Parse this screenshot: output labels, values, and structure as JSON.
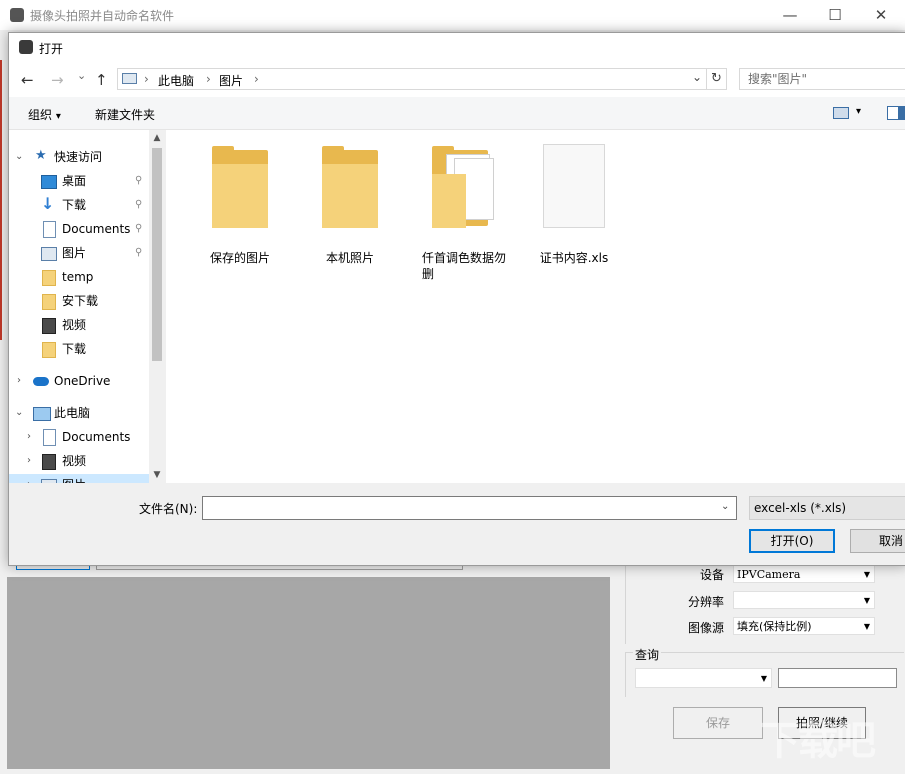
{
  "background_app": {
    "title": "摄像头拍照并自动命名软件",
    "minimize": "—",
    "maximize": "☐",
    "close": "✕",
    "device_label": "设备",
    "device_value": "IPVCamera",
    "resolution_label": "分辨率",
    "resolution_value": "",
    "source_label": "图像源",
    "source_value": "填充(保持比例)",
    "query_label": "查询",
    "save_label": "保存",
    "capture_label": "拍照/继续",
    "watermark": "下载吧"
  },
  "dialog": {
    "title": "打开",
    "nav": {
      "back_icon": "←",
      "forward_icon": "→",
      "recent_icon": "⌄",
      "up_icon": "↑",
      "breadcrumb": [
        "此电脑",
        "图片"
      ],
      "separator": "›",
      "dropdown_icon": "⌄",
      "refresh_icon": "↻",
      "search_placeholder": "搜索\"图片\""
    },
    "toolbar": {
      "organize": "组织",
      "organize_arrow": "▾",
      "new_folder": "新建文件夹",
      "view_arrow": "▾"
    },
    "tree": [
      {
        "label": "快速访问",
        "icon": "star-icon",
        "expand": "⌄",
        "pinned": false
      },
      {
        "label": "桌面",
        "icon": "desktop-icon",
        "expand": "",
        "pinned": true
      },
      {
        "label": "下载",
        "icon": "download-arrow-icon",
        "expand": "",
        "pinned": true
      },
      {
        "label": "Documents",
        "icon": "document-icon",
        "expand": "",
        "pinned": true
      },
      {
        "label": "图片",
        "icon": "pictures-icon",
        "expand": "",
        "pinned": true
      },
      {
        "label": "temp",
        "icon": "folder-icon",
        "expand": "",
        "pinned": false
      },
      {
        "label": "安下载",
        "icon": "folder-icon",
        "expand": "",
        "pinned": false
      },
      {
        "label": "视频",
        "icon": "video-icon",
        "expand": "",
        "pinned": false
      },
      {
        "label": "下载",
        "icon": "folder-icon",
        "expand": "",
        "pinned": false
      },
      {
        "label": "OneDrive",
        "icon": "cloud-icon",
        "expand": "›",
        "pinned": false
      },
      {
        "label": "此电脑",
        "icon": "computer-icon",
        "expand": "⌄",
        "pinned": false
      },
      {
        "label": "Documents",
        "icon": "document-icon",
        "expand": "›",
        "pinned": false
      },
      {
        "label": "视频",
        "icon": "video-icon",
        "expand": "›",
        "pinned": false
      },
      {
        "label": "图片",
        "icon": "pictures-icon",
        "expand": "›",
        "pinned": false
      }
    ],
    "pin_glyph": "📌",
    "files": [
      {
        "name": "保存的图片",
        "type": "folder"
      },
      {
        "name": "本机照片",
        "type": "folder"
      },
      {
        "name": "仟首调色数据勿删",
        "type": "folder-with-docs"
      },
      {
        "name": "证书内容.xls",
        "type": "file"
      }
    ],
    "filename_label": "文件名(N):",
    "filename_value": "",
    "filetype_value": "excel-xls (*.xls)",
    "open_button": "打开(O)",
    "cancel_button": "取消"
  }
}
